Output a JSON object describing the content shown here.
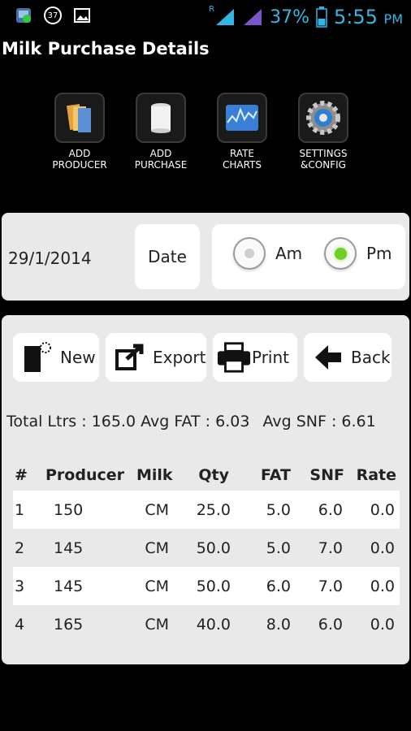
{
  "status_bar": {
    "left_icons": [
      "whatsapp-icon",
      "notification-37-icon",
      "image-icon"
    ],
    "notification_count": "37",
    "roaming": "R",
    "battery": "37%",
    "time": "5:55",
    "ampm": "PM",
    "accent": "#33b5e5"
  },
  "page": {
    "title": "Milk Purchase Details"
  },
  "toolbar": [
    {
      "label": "ADD\nPRODUCER",
      "icon": "folders-icon"
    },
    {
      "label": "ADD\nPURCHASE",
      "icon": "milk-can-icon"
    },
    {
      "label": "RATE\nCHARTS",
      "icon": "chart-icon"
    },
    {
      "label": "SETTINGS\n&CONFIG",
      "icon": "gear-icon"
    }
  ],
  "date_panel": {
    "date_value": "29/1/2014",
    "date_button": "Date",
    "am_label": "Am",
    "pm_label": "Pm",
    "selected": "Pm",
    "selected_color": "#6fcf28"
  },
  "actions": [
    {
      "label": "New",
      "icon": "new-document-icon"
    },
    {
      "label": "Export",
      "icon": "export-icon"
    },
    {
      "label": "Print",
      "icon": "printer-icon"
    },
    {
      "label": "Back",
      "icon": "back-arrow-icon"
    }
  ],
  "summary": {
    "total_ltrs": "Total Ltrs : 165.0",
    "avg_fat": "Avg FAT : 6.03",
    "avg_snf": "Avg SNF : 6.61"
  },
  "table": {
    "headers": [
      "#",
      "Producer",
      "Milk",
      "Qty",
      "FAT",
      "SNF",
      "Rate"
    ],
    "rows": [
      [
        "1",
        "150",
        "CM",
        "25.0",
        "5.0",
        "6.0",
        "0.0"
      ],
      [
        "2",
        "145",
        "CM",
        "50.0",
        "5.0",
        "7.0",
        "0.0"
      ],
      [
        "3",
        "145",
        "CM",
        "50.0",
        "6.0",
        "7.0",
        "0.0"
      ],
      [
        "4",
        "165",
        "CM",
        "40.0",
        "8.0",
        "6.0",
        "0.0"
      ]
    ]
  }
}
